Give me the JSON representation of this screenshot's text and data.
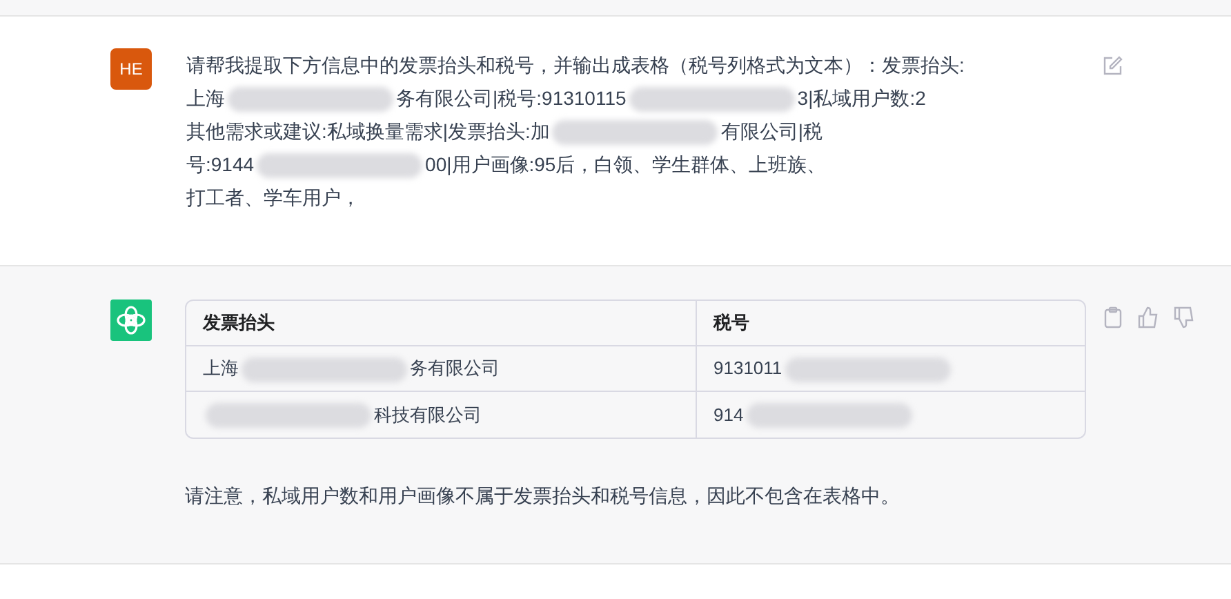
{
  "user_message": {
    "avatar": "HE",
    "lines": [
      [
        {
          "kind": "text",
          "text": "请帮我提取下方信息中的发票抬头和税号，并输出成表格（税号列格式为文本）：发票抬头:"
        }
      ],
      [
        {
          "kind": "text",
          "text": "上海"
        },
        {
          "kind": "redacted"
        },
        {
          "kind": "text",
          "text": "务有限公司|税号:91310115"
        },
        {
          "kind": "redacted"
        },
        {
          "kind": "text",
          "text": "3|私域用户数:2"
        }
      ],
      [
        {
          "kind": "text",
          "text": "其他需求或建议:私域换量需求|发票抬头:加"
        },
        {
          "kind": "redacted"
        },
        {
          "kind": "text",
          "text": "有限公司|税"
        }
      ],
      [
        {
          "kind": "text",
          "text": "号:9144"
        },
        {
          "kind": "redacted"
        },
        {
          "kind": "text",
          "text": "00|用户画像:95后，白领、学生群体、上班族、"
        }
      ],
      [
        {
          "kind": "text",
          "text": "打工者、学车用户，"
        }
      ]
    ]
  },
  "assistant_message": {
    "table": {
      "columns": [
        "发票抬头",
        "税号"
      ],
      "rows": [
        [
          [
            {
              "kind": "text",
              "text": "上海"
            },
            {
              "kind": "redacted"
            },
            {
              "kind": "text",
              "text": "务有限公司"
            }
          ],
          [
            {
              "kind": "text",
              "text": "9131011"
            },
            {
              "kind": "redacted"
            }
          ]
        ],
        [
          [
            {
              "kind": "redacted"
            },
            {
              "kind": "text",
              "text": "科技有限公司"
            }
          ],
          [
            {
              "kind": "text",
              "text": "914"
            },
            {
              "kind": "redacted"
            }
          ]
        ]
      ]
    },
    "note": "请注意，私域用户数和用户画像不属于发票抬头和税号信息，因此不包含在表格中。"
  }
}
